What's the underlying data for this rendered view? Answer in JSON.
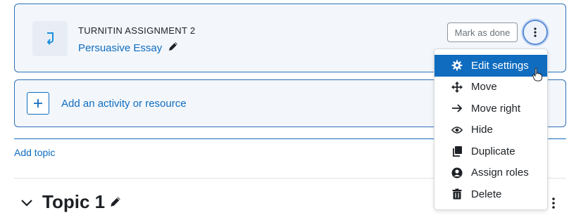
{
  "activity": {
    "type_label": "TURNITIN ASSIGNMENT 2",
    "name": "Persuasive Essay",
    "mark_done_label": "Mark as done"
  },
  "add_activity": {
    "label": "Add an activity or resource"
  },
  "add_topic": {
    "label": "Add topic"
  },
  "topic": {
    "title": "Topic 1"
  },
  "menu": {
    "items": [
      {
        "label": "Edit settings",
        "icon": "gear-icon",
        "active": true
      },
      {
        "label": "Move",
        "icon": "move-icon"
      },
      {
        "label": "Move right",
        "icon": "arrow-right-icon"
      },
      {
        "label": "Hide",
        "icon": "eye-icon"
      },
      {
        "label": "Duplicate",
        "icon": "copy-icon"
      },
      {
        "label": "Assign roles",
        "icon": "user-circle-icon"
      },
      {
        "label": "Delete",
        "icon": "trash-icon"
      }
    ]
  },
  "colors": {
    "accent": "#0f6cbf",
    "card_border": "#2f6fb5",
    "card_bg": "#f3f7fc",
    "text": "#1d2125"
  }
}
